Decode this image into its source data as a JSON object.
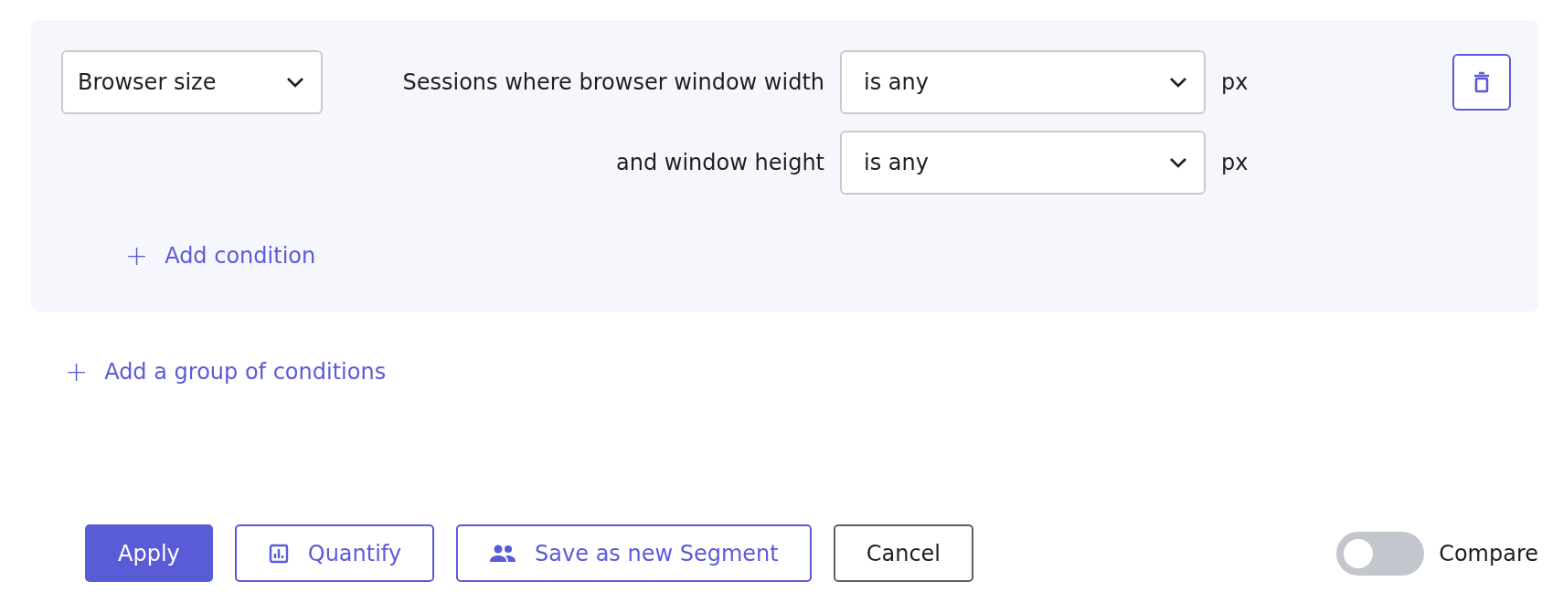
{
  "group": {
    "field": "Browser size",
    "rows": [
      {
        "label": "Sessions where browser window width",
        "operator": "is any",
        "unit": "px"
      },
      {
        "label": "and window height",
        "operator": "is any",
        "unit": "px"
      }
    ],
    "add_condition": {
      "icon": "+",
      "label": "Add condition"
    }
  },
  "add_group": {
    "icon": "+",
    "label": "Add a group of conditions"
  },
  "buttons": [
    {
      "kind": "primary",
      "label": "Apply"
    },
    {
      "kind": "chart",
      "label": "Quantify"
    },
    {
      "kind": "people",
      "label": "Save as new Segment"
    },
    {
      "kind": "plain",
      "label": "Cancel"
    }
  ],
  "compare": {
    "label": "Compare",
    "on": false
  }
}
